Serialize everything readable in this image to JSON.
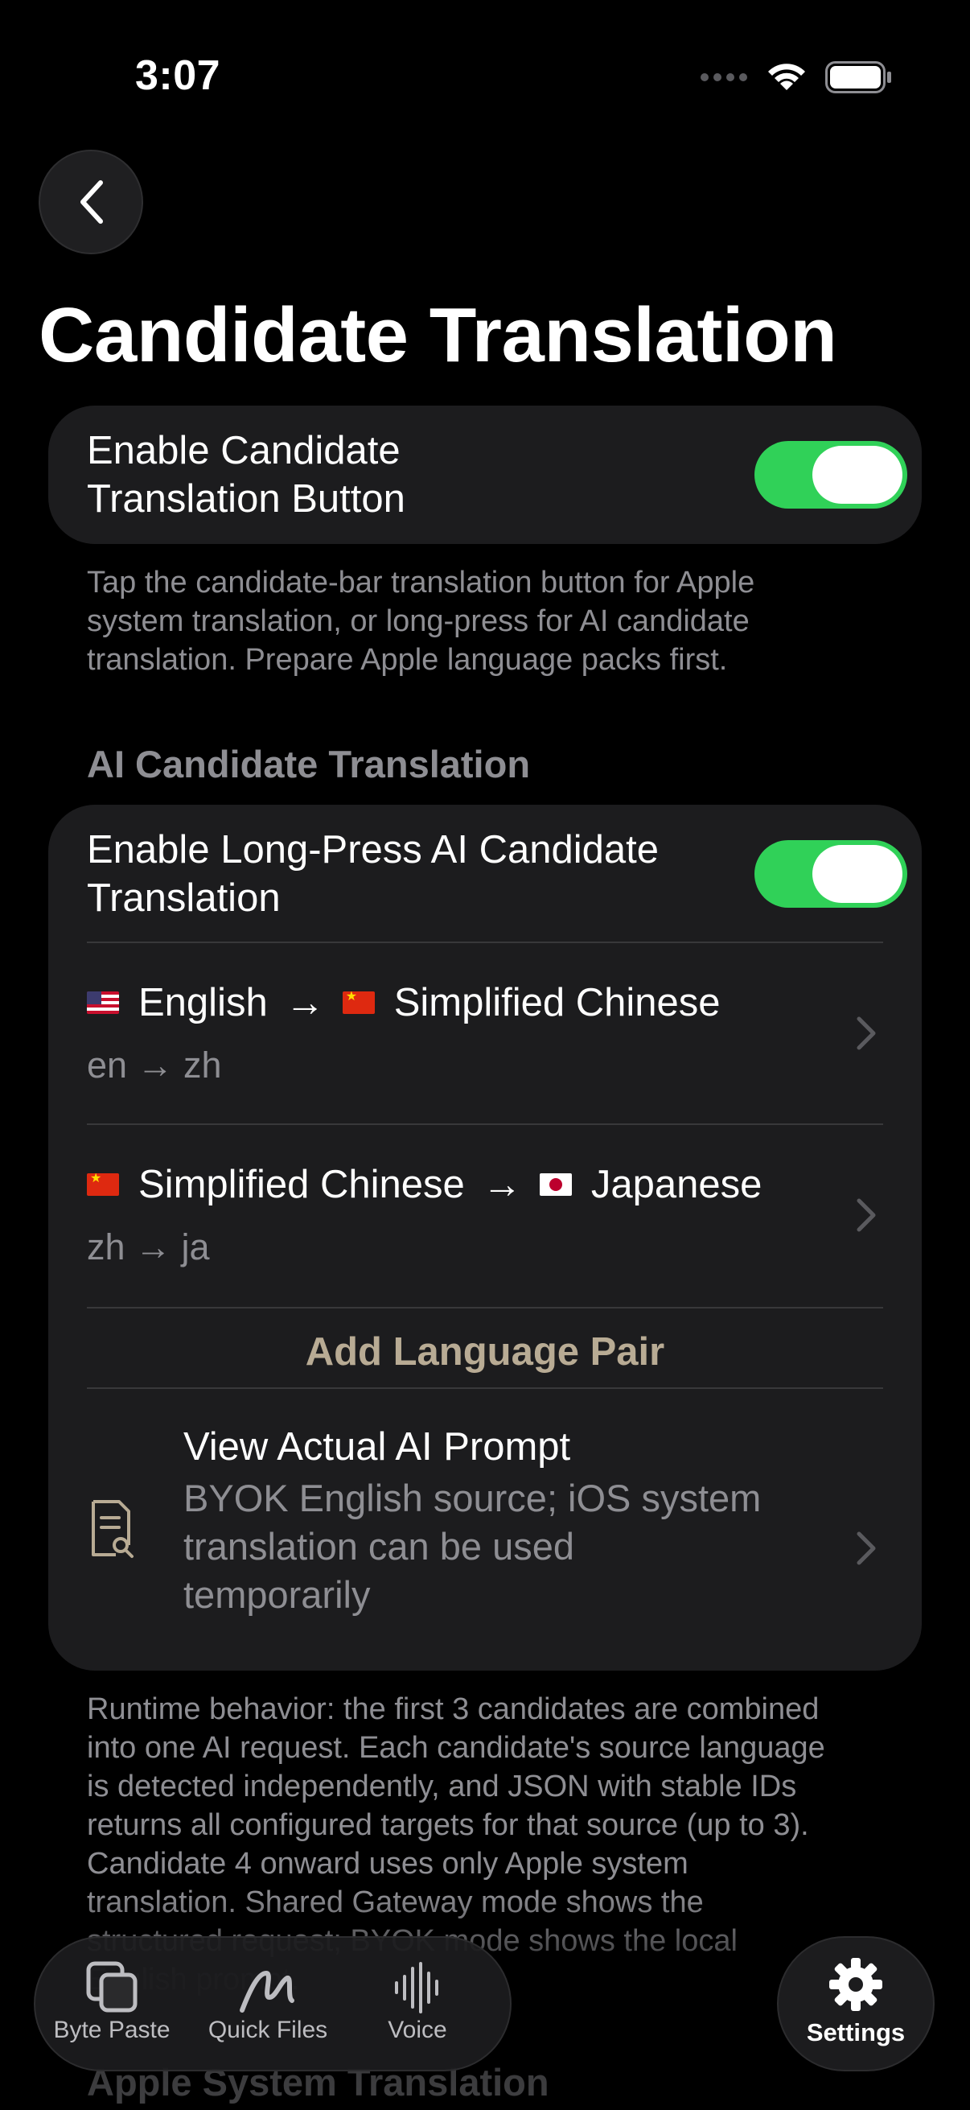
{
  "status_bar": {
    "time": "3:07"
  },
  "nav": {
    "back_icon": "chevron-left-icon"
  },
  "page": {
    "title": "Candidate Translation"
  },
  "main_toggle": {
    "label_line1": "Enable Candidate",
    "label_line2": "Translation Button",
    "on": true
  },
  "main_footnote": {
    "line1": "Tap the candidate-bar translation button for Apple",
    "line2": "system translation, or long-press for AI candidate",
    "line3": "translation. Prepare Apple language packs first."
  },
  "ai_section": {
    "header": "AI Candidate Translation",
    "toggle_label_line1": "Enable Long-Press AI Candidate",
    "toggle_label_line2": "Translation",
    "toggle_on": true,
    "pairs": [
      {
        "source_flag": "us-flag-icon",
        "source": "English",
        "arrow": "→",
        "target_flag": "cn-flag-icon",
        "target": "Simplified Chinese",
        "codes": "en → zh"
      },
      {
        "source_flag": "cn-flag-icon",
        "source": "Simplified Chinese",
        "arrow": "→",
        "target_flag": "jp-flag-icon",
        "target": "Japanese",
        "codes": "zh → ja"
      }
    ],
    "add_pair_label": "Add Language Pair",
    "prompt_row": {
      "icon": "document-search-icon",
      "title": "View Actual AI Prompt",
      "subtitle_line1": "BYOK English source; iOS system",
      "subtitle_line2": "translation can be used",
      "subtitle_line3": "temporarily"
    }
  },
  "runtime_footnote": {
    "line1": "Runtime behavior: the first 3 candidates are combined",
    "line2": "into one AI request. Each candidate's source language",
    "line3": "is detected independently, and JSON with stable IDs",
    "line4": "returns all configured targets for that source (up to 3).",
    "line5": "Candidate 4 onward uses only Apple system",
    "line6": "translation. Shared Gateway mode shows the",
    "line7": "structured request; BYOK mode shows the local",
    "line8": "English prompt."
  },
  "next_section": {
    "header": "Apple System Translation"
  },
  "tab_bar": {
    "tabs": [
      {
        "label": "Byte Paste",
        "icon": "copy-icon"
      },
      {
        "label": "Quick Files",
        "icon": "scribble-icon"
      },
      {
        "label": "Voice",
        "icon": "waveform-icon"
      }
    ],
    "settings": {
      "label": "Settings",
      "icon": "gear-icon",
      "active": true
    }
  }
}
